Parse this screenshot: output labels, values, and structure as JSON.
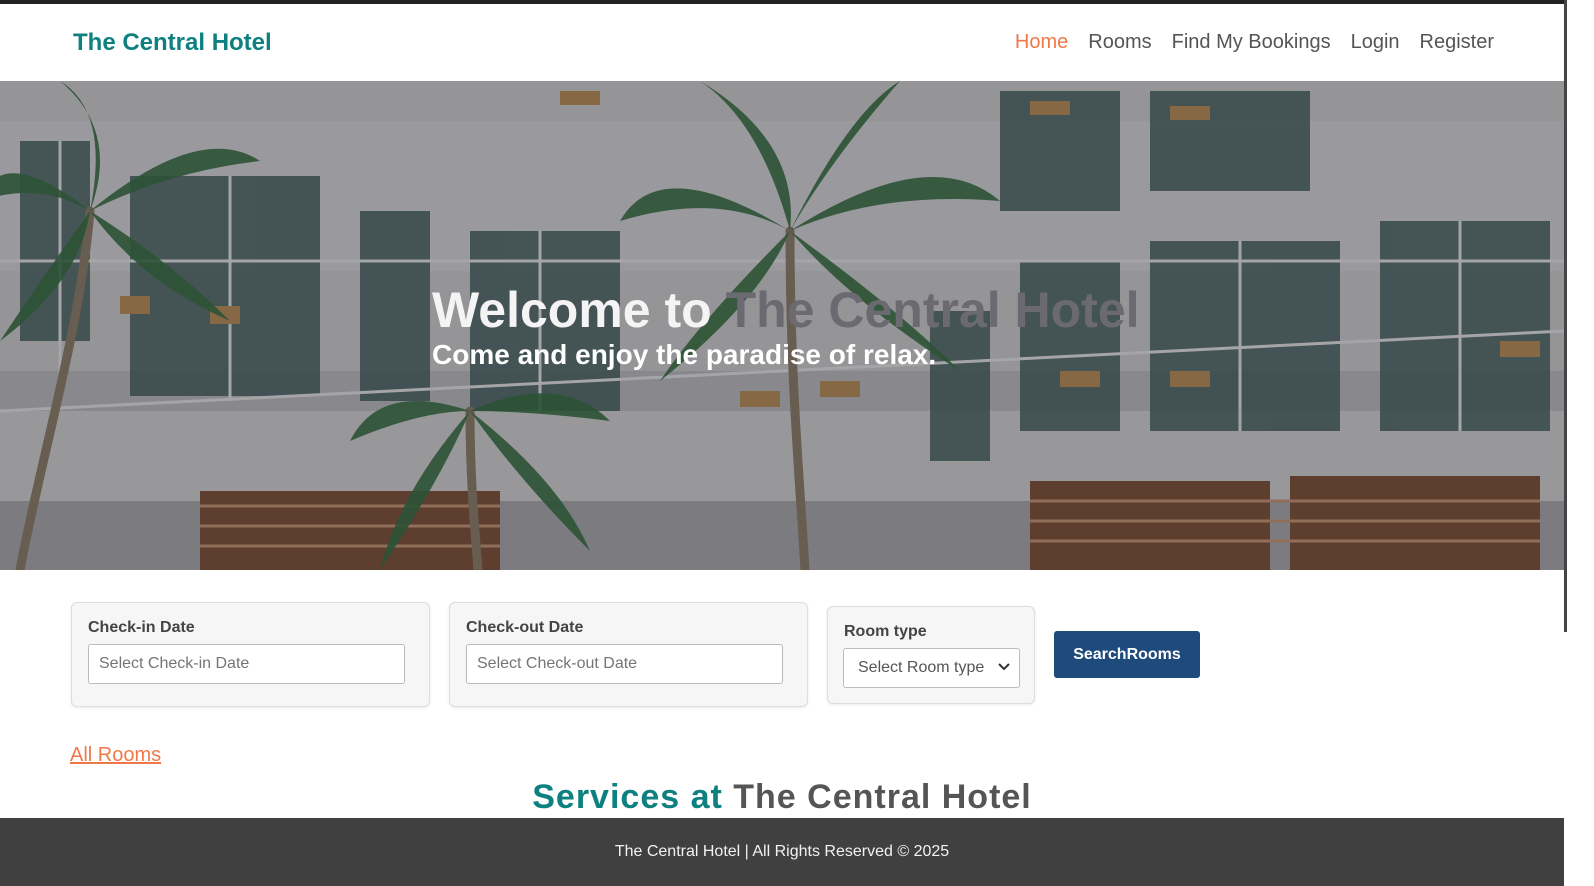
{
  "navbar": {
    "brand": "The Central Hotel",
    "links": [
      {
        "label": "Home",
        "active": true
      },
      {
        "label": "Rooms"
      },
      {
        "label": "Find My Bookings"
      },
      {
        "label": "Login"
      },
      {
        "label": "Register"
      }
    ]
  },
  "hero": {
    "title_prefix": "Welcome to ",
    "title_highlight": "The Central Hotel",
    "subtitle": "Come and enjoy the paradise of relax."
  },
  "search": {
    "checkin_label": "Check-in Date",
    "checkin_placeholder": "Select Check-in Date",
    "checkout_label": "Check-out Date",
    "checkout_placeholder": "Select Check-out Date",
    "roomtype_label": "Room type",
    "roomtype_selected": "Select Room type",
    "button_label": "SearchRooms"
  },
  "links": {
    "all_rooms": "All Rooms"
  },
  "services": {
    "title_prefix": "Services at ",
    "title_highlight": "The Central Hotel"
  },
  "footer": {
    "text": "The Central Hotel | All Rights Reserved © 2025"
  },
  "colors": {
    "brand": "#0e8080",
    "active_link": "#f07848",
    "button": "#1f4a7c",
    "footer_bg": "#404040"
  },
  "icons": {
    "select_chevron": "chevron-down-icon"
  }
}
